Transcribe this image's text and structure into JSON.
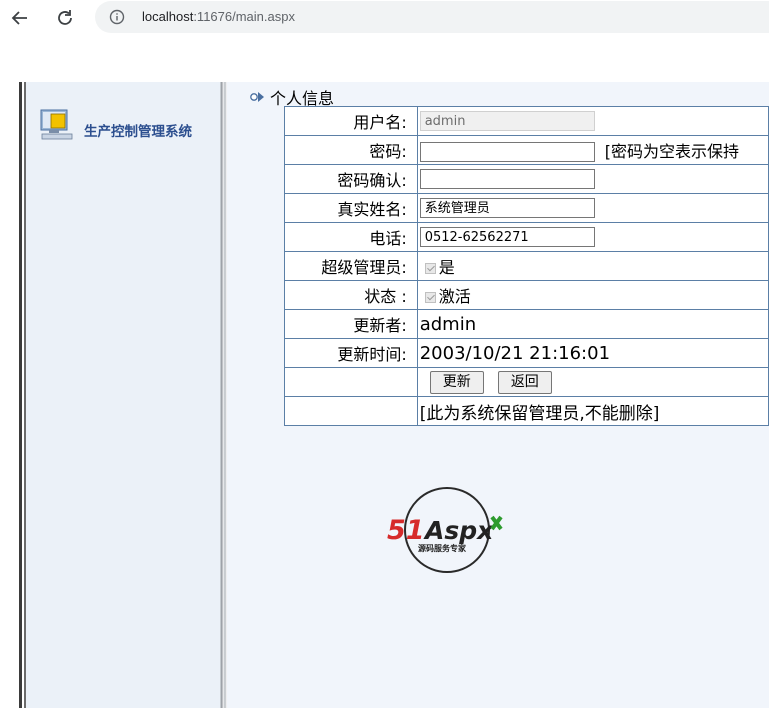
{
  "browser": {
    "url_host": "localhost",
    "url_rest": ":11676/main.aspx"
  },
  "sidebar": {
    "system_title": "生产控制管理系统"
  },
  "section": {
    "title": "个人信息"
  },
  "form": {
    "username_label": "用户名:",
    "username_value": "admin",
    "password_label": "密码:",
    "password_value": "",
    "password_hint": "[密码为空表示保持",
    "password_confirm_label": "密码确认:",
    "password_confirm_value": "",
    "realname_label": "真实姓名:",
    "realname_value": "系统管理员",
    "phone_label": "电话:",
    "phone_value": "0512-62562271",
    "superadmin_label": "超级管理员:",
    "superadmin_text": "是",
    "status_label": "状态 :",
    "status_text": "激活",
    "updater_label": "更新者:",
    "updater_value": "admin",
    "updatetime_label": "更新时间:",
    "updatetime_value": "2003/10/21 21:16:01",
    "update_button": "更新",
    "back_button": "返回",
    "notice": "[此为系统保留管理员,不能删除]"
  },
  "watermark": {
    "brand": "51Aspx",
    "tagline": "源码服务专家"
  },
  "colors": {
    "accent": "#2c4f8f",
    "table_border": "#5b7fa6",
    "sidebar_bg": "#ebf1f8",
    "content_bg": "#f1f5fb"
  }
}
